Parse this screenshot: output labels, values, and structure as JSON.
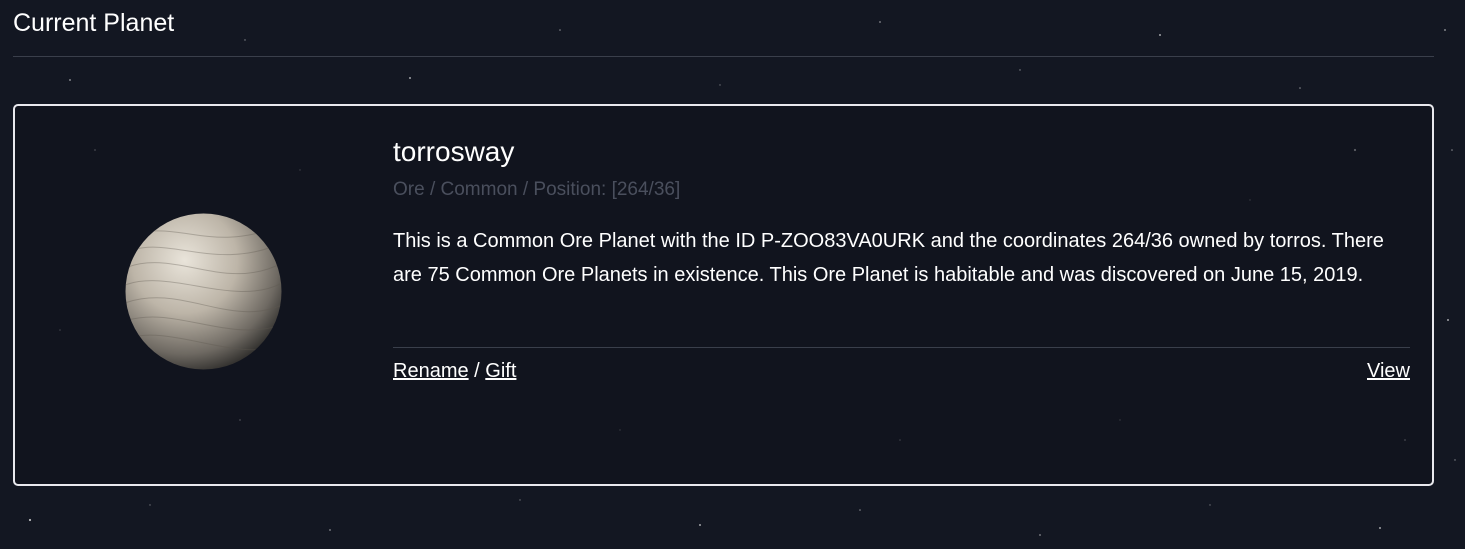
{
  "section": {
    "title": "Current Planet"
  },
  "planet": {
    "name": "torrosway",
    "meta": "Ore / Common / Position: [264/36]",
    "description": "This is a Common Ore Planet with the ID P-ZOO83VA0URK and the coordinates 264/36 owned by torros. There are 75 Common Ore Planets in existence. This Ore Planet is habitable and was discovered on June 15, 2019.",
    "image_icon": "ore-planet-image"
  },
  "actions": {
    "rename_label": "Rename",
    "separator": "/",
    "gift_label": "Gift",
    "view_label": "View"
  },
  "colors": {
    "background": "#131722",
    "card_border": "#e9e9ee",
    "meta_text": "#4a4f5d",
    "text": "#ffffff"
  }
}
